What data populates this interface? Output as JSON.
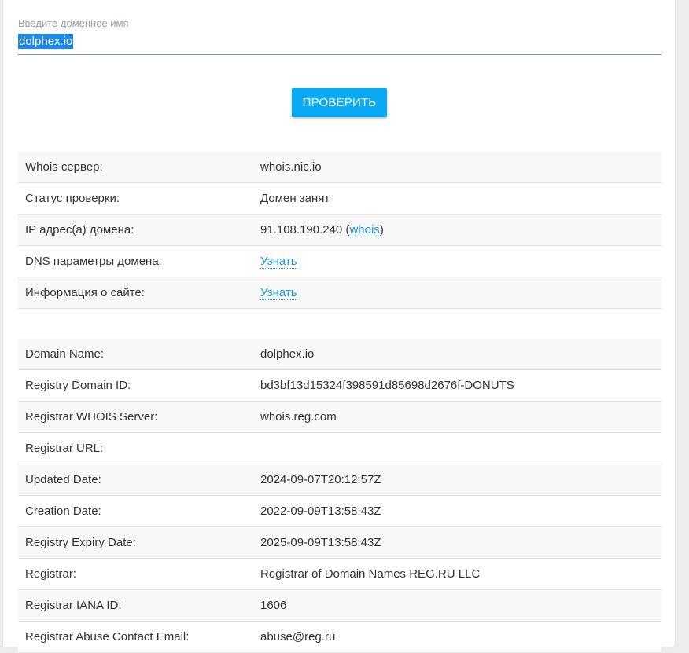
{
  "domain_field": {
    "label": "Введите доменное имя",
    "value": "dolphex.io"
  },
  "check_button": {
    "label": "ПРОВЕРИТЬ"
  },
  "summary": {
    "whois_server": {
      "key": "Whois сервер:",
      "value": "whois.nic.io"
    },
    "status": {
      "key": "Статус проверки:",
      "value": "Домен занят"
    },
    "ip": {
      "key": "IP адрес(а) домена:",
      "value": "91.108.190.240",
      "open": " (",
      "link": "whois",
      "close": ")"
    },
    "dns": {
      "key": "DNS параметры домена:",
      "link": "Узнать"
    },
    "site_info": {
      "key": "Информация о сайте:",
      "link": "Узнать"
    }
  },
  "whois_records": [
    {
      "key": "Domain Name:",
      "value": "dolphex.io"
    },
    {
      "key": "Registry Domain ID:",
      "value": "bd3bf13d15324f398591d85698d2676f-DONUTS"
    },
    {
      "key": "Registrar WHOIS Server:",
      "value": "whois.reg.com"
    },
    {
      "key": "Registrar URL:",
      "value": ""
    },
    {
      "key": "Updated Date:",
      "value": "2024-09-07T20:12:57Z"
    },
    {
      "key": "Creation Date:",
      "value": "2022-09-09T13:58:43Z"
    },
    {
      "key": "Registry Expiry Date:",
      "value": "2025-09-09T13:58:43Z"
    },
    {
      "key": "Registrar:",
      "value": "Registrar of Domain Names REG.RU LLC"
    },
    {
      "key": "Registrar IANA ID:",
      "value": "1606"
    },
    {
      "key": "Registrar Abuse Contact Email:",
      "value": "abuse@reg.ru"
    }
  ]
}
